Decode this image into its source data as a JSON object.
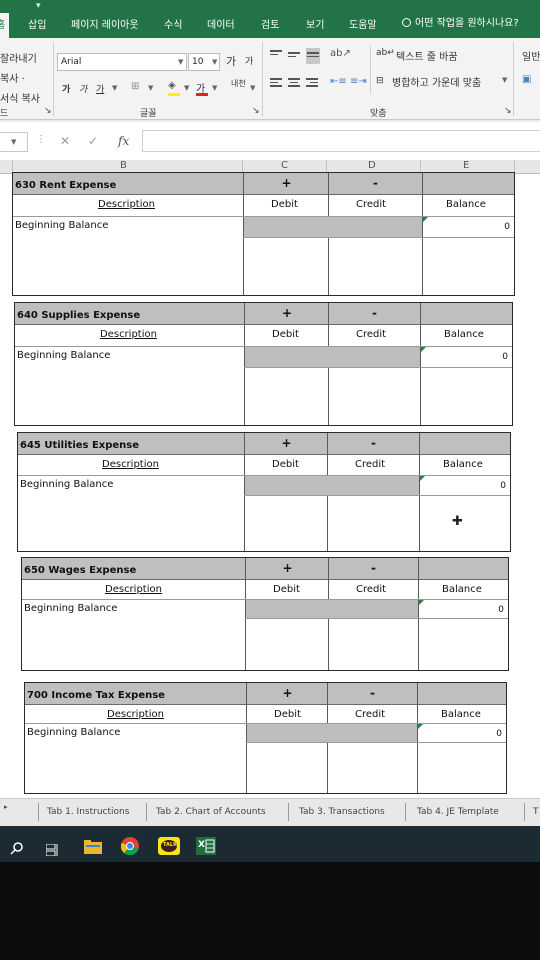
{
  "ribbon": {
    "tabs": [
      {
        "label": "홈",
        "active": true
      },
      {
        "label": "삽입"
      },
      {
        "label": "페이지 레이아웃"
      },
      {
        "label": "수식"
      },
      {
        "label": "데이터"
      },
      {
        "label": "검토"
      },
      {
        "label": "보기"
      },
      {
        "label": "도움말"
      }
    ],
    "tell_me": "어떤 작업을 원하시나요?",
    "clipboard": {
      "cut": "잘라내기",
      "copy": "복사 ·",
      "format_painter": "서식 복사",
      "group_label": "드"
    },
    "font": {
      "name": "Arial",
      "size": "10",
      "grow": "가",
      "shrink": "가",
      "bold": "가",
      "italic": "가",
      "underline": "가",
      "font_color": "가",
      "phonetic": "내천",
      "group_label": "글꼴"
    },
    "alignment": {
      "wrap_text": "텍스트 줄 바꿈",
      "merge_center": "병합하고 가운데 맞춤",
      "group_label": "맞춤"
    },
    "number": {
      "format": "일반"
    }
  },
  "formula_bar": {
    "cancel": "✕",
    "enter": "✓",
    "fx": "fx",
    "value": ""
  },
  "columns": [
    "B",
    "C",
    "D",
    "E"
  ],
  "ledgers": [
    {
      "title": "630 Rent Expense",
      "plus": "+",
      "minus": "-",
      "description": "Description",
      "debit": "Debit",
      "credit": "Credit",
      "balance": "Balance",
      "row_label": "Beginning Balance",
      "balance_value": "0"
    },
    {
      "title": "640 Supplies Expense",
      "plus": "+",
      "minus": "-",
      "description": "Description",
      "debit": "Debit",
      "credit": "Credit",
      "balance": "Balance",
      "row_label": "Beginning Balance",
      "balance_value": "0"
    },
    {
      "title": "645 Utilities Expense",
      "plus": "+",
      "minus": "-",
      "description": "Description",
      "debit": "Debit",
      "credit": "Credit",
      "balance": "Balance",
      "row_label": "Beginning Balance",
      "balance_value": "0"
    },
    {
      "title": "650 Wages Expense",
      "plus": "+",
      "minus": "-",
      "description": "Description",
      "debit": "Debit",
      "credit": "Credit",
      "balance": "Balance",
      "row_label": "Beginning Balance",
      "balance_value": "0"
    },
    {
      "title": "700 Income Tax Expense",
      "plus": "+",
      "minus": "-",
      "description": "Description",
      "debit": "Debit",
      "credit": "Credit",
      "balance": "Balance",
      "row_label": "Beginning Balance",
      "balance_value": "0"
    }
  ],
  "sheet_tabs": [
    {
      "label": "Tab 1. Instructions"
    },
    {
      "label": "Tab 2. Chart of Accounts"
    },
    {
      "label": "Tab 3. Transactions"
    },
    {
      "label": "Tab 4. JE Template"
    },
    {
      "label": "T"
    }
  ],
  "taskbar": {
    "icons": [
      "search-icon",
      "task-view-icon",
      "file-explorer-icon",
      "chrome-icon",
      "kakaotalk-icon",
      "excel-icon"
    ],
    "kakao_label": "TALK",
    "excel_label": "X"
  },
  "colors": {
    "excel_green": "#227447",
    "header_gray": "#bfbfbf",
    "taskbar": "#1b2a33"
  }
}
